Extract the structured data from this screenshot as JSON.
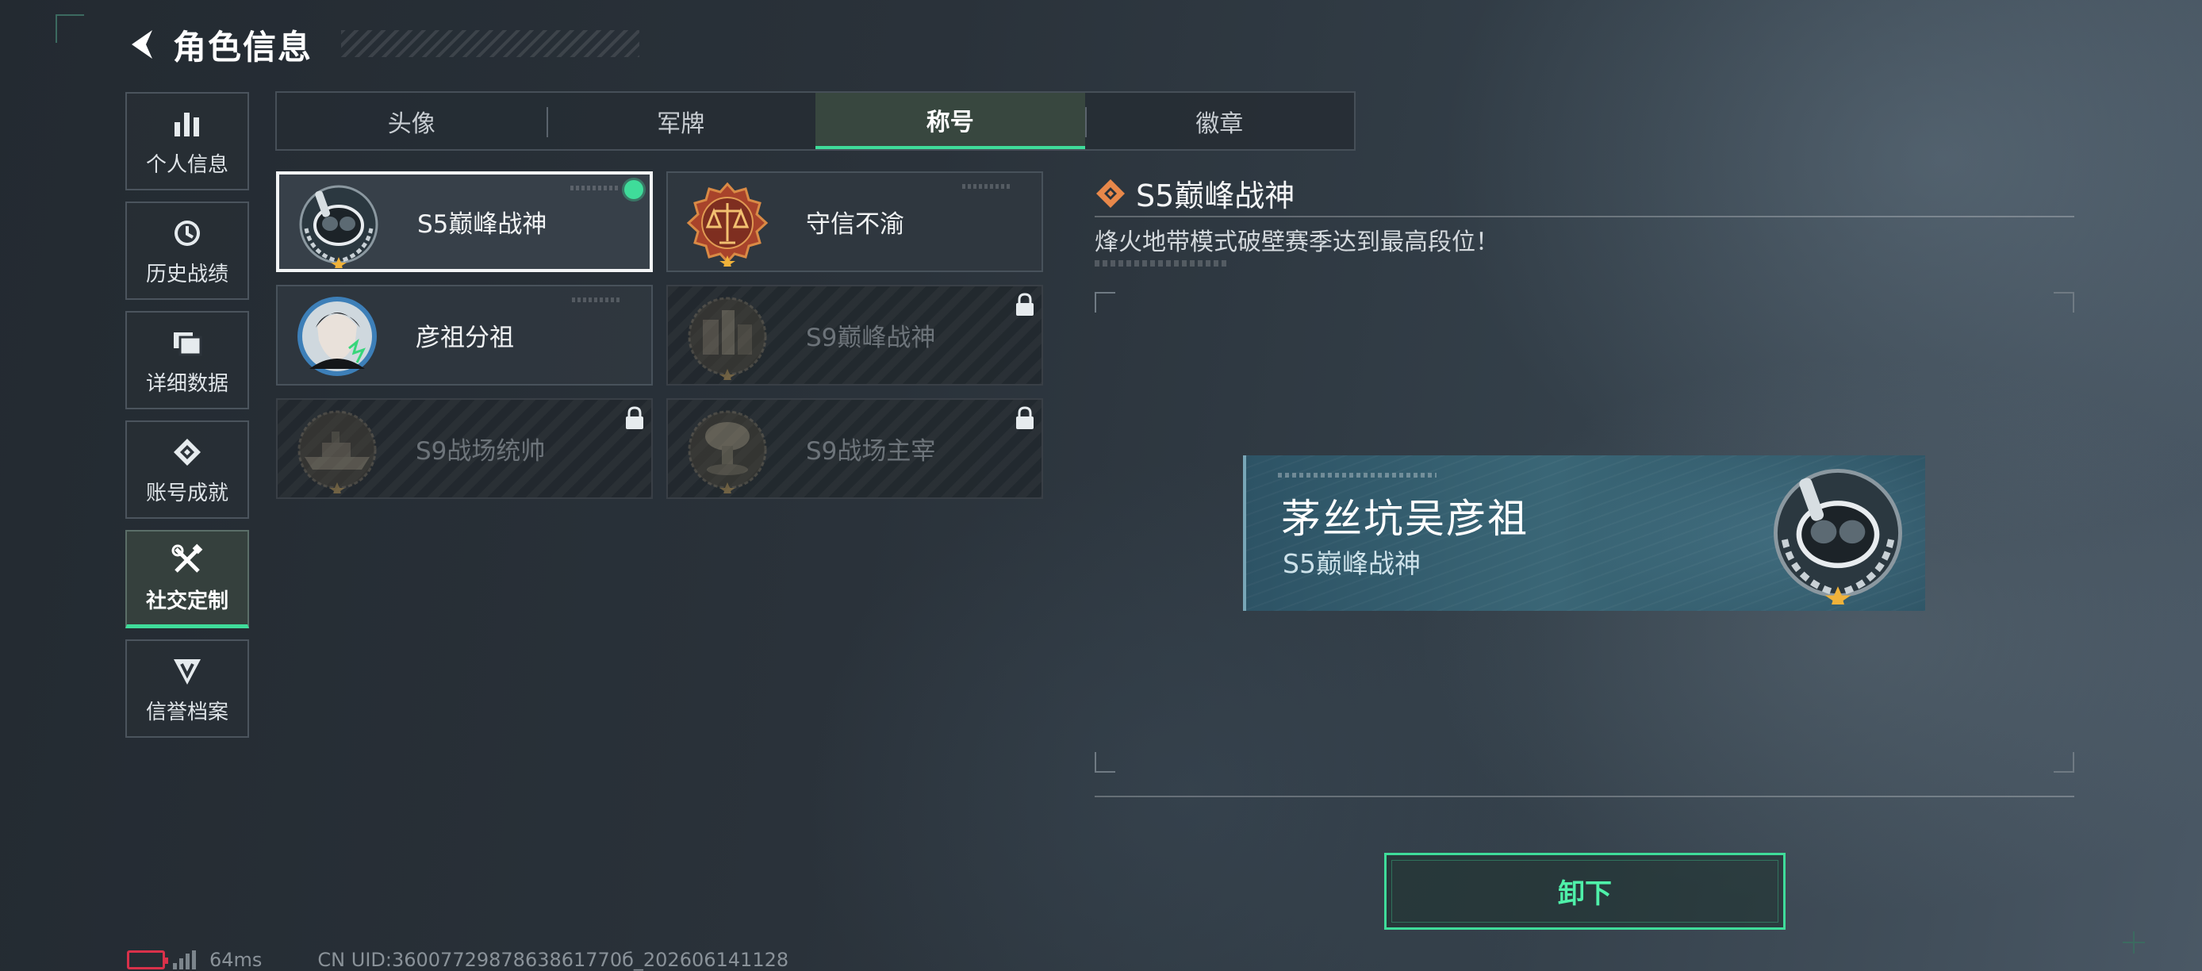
{
  "header": {
    "title": "角色信息"
  },
  "sidebar": {
    "items": [
      {
        "label": "个人信息",
        "icon": "bar-chart-icon",
        "active": false
      },
      {
        "label": "历史战绩",
        "icon": "history-clock-icon",
        "active": false
      },
      {
        "label": "详细数据",
        "icon": "folder-icon",
        "active": false
      },
      {
        "label": "账号成就",
        "icon": "achievement-icon",
        "active": false
      },
      {
        "label": "社交定制",
        "icon": "tools-icon",
        "active": true
      },
      {
        "label": "信誉档案",
        "icon": "credit-shield-icon",
        "active": false
      }
    ]
  },
  "tabs": [
    {
      "label": "头像",
      "active": false
    },
    {
      "label": "军牌",
      "active": false
    },
    {
      "label": "称号",
      "active": true
    },
    {
      "label": "徽章",
      "active": false
    }
  ],
  "titles": [
    {
      "name": "S5巅峰战神",
      "emblem": "diving-mask-emblem",
      "selected": true,
      "equipped": true,
      "locked": false
    },
    {
      "name": "守信不渝",
      "emblem": "justice-scale-emblem",
      "selected": false,
      "equipped": false,
      "locked": false
    },
    {
      "name": "彦祖分祖",
      "emblem": "portrait-emblem",
      "selected": false,
      "equipped": false,
      "locked": false
    },
    {
      "name": "S9巅峰战神",
      "emblem": "fortress-emblem",
      "selected": false,
      "equipped": false,
      "locked": true
    },
    {
      "name": "S9战场统帅",
      "emblem": "warship-emblem",
      "selected": false,
      "equipped": false,
      "locked": true
    },
    {
      "name": "S9战场主宰",
      "emblem": "mushroom-cloud-emblem",
      "selected": false,
      "equipped": false,
      "locked": true
    }
  ],
  "detail": {
    "title": "S5巅峰战神",
    "description": "烽火地带模式破壁赛季达到最高段位！",
    "icon": "orange-diamond-icon"
  },
  "preview": {
    "player_name": "茅丝坑吴彦祖",
    "title": "S5巅峰战神"
  },
  "actions": {
    "unequip_label": "卸下"
  },
  "footer": {
    "ping": "64ms",
    "uid": "CN UID:3600772987863861770б_202606141128"
  },
  "colors": {
    "accent": "#3fdc9a",
    "battery_low": "#d9314a",
    "detail_icon": "#e8884a",
    "preview_card": "#3a6676"
  }
}
